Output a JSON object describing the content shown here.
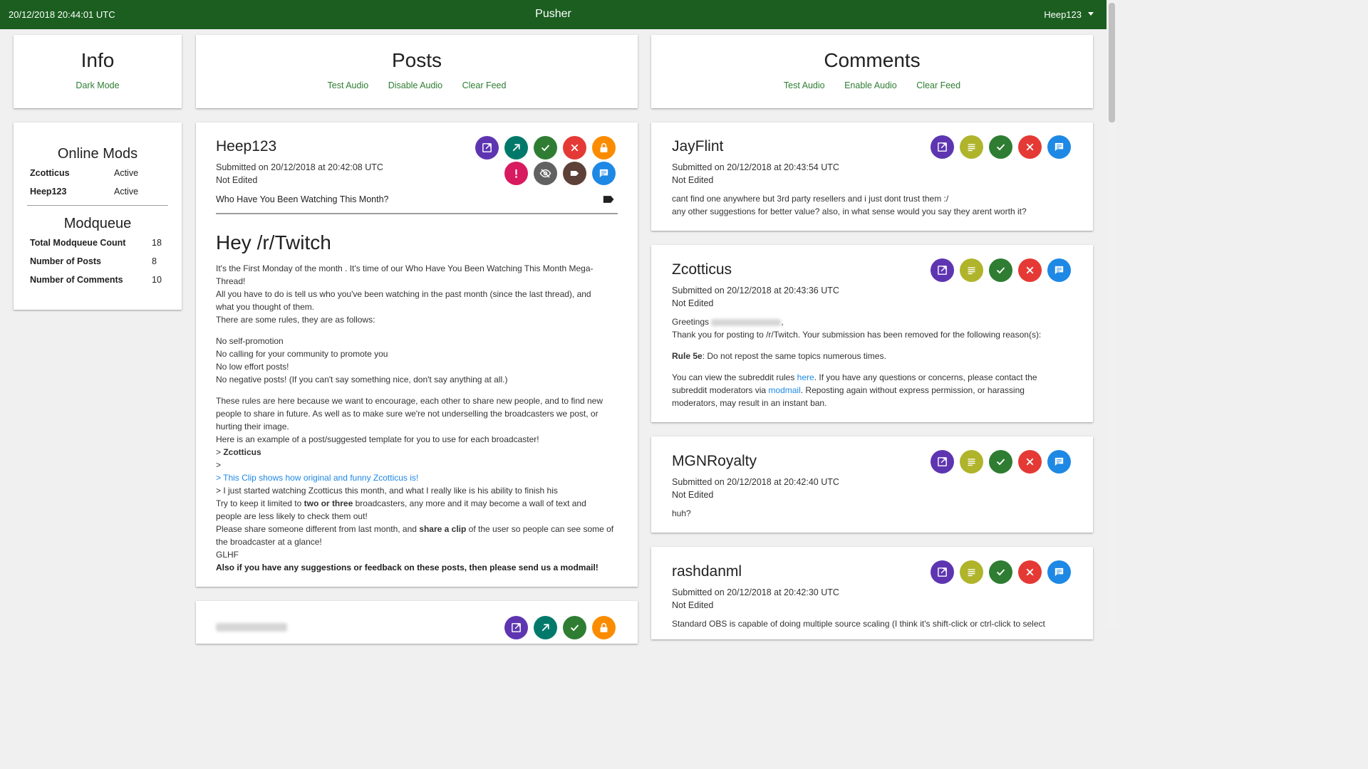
{
  "topbar": {
    "datetime": "20/12/2018 20:44:01 UTC",
    "app_title": "Pusher",
    "user": "Heep123"
  },
  "info": {
    "title": "Info",
    "dark_mode": "Dark Mode",
    "online_mods_title": "Online Mods",
    "mods": [
      {
        "name": "Zcotticus",
        "status": "Active"
      },
      {
        "name": "Heep123",
        "status": "Active"
      }
    ],
    "modqueue_title": "Modqueue",
    "stats": [
      {
        "label": "Total Modqueue Count",
        "value": "18"
      },
      {
        "label": "Number of Posts",
        "value": "8"
      },
      {
        "label": "Number of Comments",
        "value": "10"
      }
    ]
  },
  "posts_header": {
    "title": "Posts",
    "test_audio": "Test Audio",
    "toggle_audio": "Disable Audio",
    "clear_feed": "Clear Feed"
  },
  "comments_header": {
    "title": "Comments",
    "test_audio": "Test Audio",
    "toggle_audio": "Enable Audio",
    "clear_feed": "Clear Feed"
  },
  "post": {
    "author": "Heep123",
    "submitted": "Submitted on 20/12/2018 at 20:42:08 UTC",
    "edited": "Not Edited",
    "title": "Who Have You Been Watching This Month?",
    "heading": "Hey /r/Twitch",
    "body": {
      "p1a": "It's the First Monday of the month . It's time of our Who Have You Been Watching This Month Mega-",
      "p1b": "Thread!",
      "p2a": "All you have to do is tell us who you've been watching in the past month (since the last thread), and",
      "p2b": "what you thought of them.",
      "p3": "There are some rules, they are as follows:",
      "r1": "No self-promotion",
      "r2": "No calling for your community to promote you",
      "r3": "No low effort posts!",
      "r4": "No negative posts! (If you can't say something nice, don't say anything at all.)",
      "p4a": "These rules are here because we want to encourage, each other to share new people, and to find new",
      "p4b": "people to share in future. As well as to make sure we're not underselling the broadcasters we post, or",
      "p4c": "hurting their image.",
      "p5": "Here is an example of a post/suggested template for you to use for each broadcaster!",
      "q1_prefix": "> ",
      "q1": "Zcotticus",
      "q2": ">",
      "q3_prefix": "> ",
      "q3": "This Clip shows how original and funny Zcotticus is!",
      "q4": "> I just started watching Zcotticus this month, and what I really like is his ability to finish his",
      "p6_a": "Try to keep it limited to ",
      "p6_b": "two or three",
      "p6_c": " broadcasters, any more and it may become a wall of text and",
      "p6_d": "people are less likely to check them out!",
      "p7_a": "Please share someone different from last month, and ",
      "p7_b": "share a clip",
      "p7_c": " of the user so people can see some of",
      "p7_d": "the broadcaster at a glance!",
      "p8": "GLHF",
      "p9": "Also if you have any suggestions or feedback on these posts, then please send us a modmail!"
    }
  },
  "comments": [
    {
      "author": "JayFlint",
      "submitted": "Submitted on 20/12/2018 at 20:43:54 UTC",
      "edited": "Not Edited",
      "line1": "cant find one anywhere but 3rd party resellers and i just dont trust them :/",
      "line2": "any other suggestions for better value? also, in what sense would you say they arent worth it?"
    },
    {
      "author": "Zcotticus",
      "submitted": "Submitted on 20/12/2018 at 20:43:36 UTC",
      "edited": "Not Edited",
      "greeting": "Greetings",
      "line1": "Thank you for posting to /r/Twitch. Your submission has been removed for the following reason(s):",
      "rule_label": "Rule 5e",
      "rule_text": ": Do not repost the same topics numerous times.",
      "l3a": "You can view the subreddit rules ",
      "l3_link": "here",
      "l3b": ". If you have any questions or concerns, please contact the",
      "l4a": "subreddit moderators via ",
      "l4_link": "modmail",
      "l4b": ". Reposting again without express permission, or harassing",
      "l5": "moderators, may result in an instant ban."
    },
    {
      "author": "MGNRoyalty",
      "submitted": "Submitted on 20/12/2018 at 20:42:40 UTC",
      "edited": "Not Edited",
      "line1": "huh?"
    },
    {
      "author": "rashdanml",
      "submitted": "Submitted on 20/12/2018 at 20:42:30 UTC",
      "edited": "Not Edited",
      "line1": "Standard OBS is capable of doing multiple source scaling (I think it's shift-click or ctrl-click to select"
    }
  ],
  "colors": {
    "topbar": "#1b5e20",
    "open": "#5e35b1",
    "permalink": "#00796b",
    "approve": "#2e7d32",
    "remove": "#e53935",
    "lock": "#fb8c00",
    "report": "#d81b60",
    "hide": "#616161",
    "flair": "#5d4037",
    "reply": "#1e88e5",
    "source": "#afb42b"
  }
}
